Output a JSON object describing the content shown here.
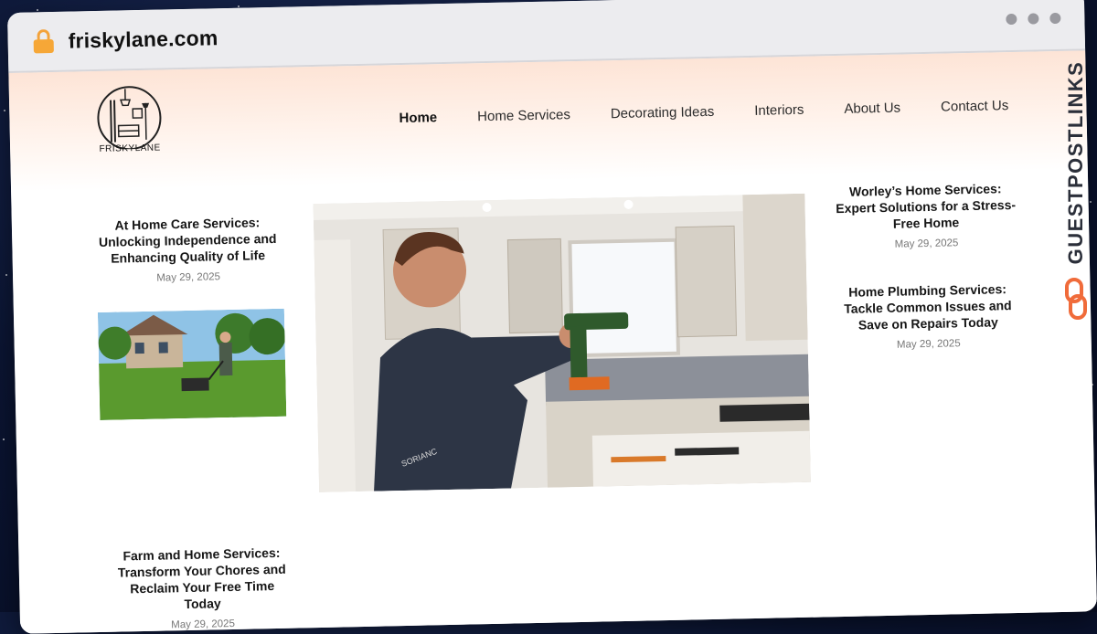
{
  "browser": {
    "url": "friskylane.com"
  },
  "site": {
    "logo_text": "FRISKYLANE",
    "nav": [
      "Home",
      "Home Services",
      "Decorating Ideas",
      "Interiors",
      "About Us",
      "Contact Us"
    ],
    "active_nav": "Home"
  },
  "articles": {
    "left_top": {
      "title": "At Home Care Services: Unlocking Independence and Enhancing Quality of Life",
      "date": "May 29, 2025"
    },
    "left_bottom": {
      "title": "Farm and Home Services: Transform Your Chores and Reclaim Your Free Time Today",
      "date": "May 29, 2025"
    },
    "right_top": {
      "title": "Worley’s Home Services: Expert Solutions for a Stress-Free Home",
      "date": "May 29, 2025"
    },
    "right_bottom": {
      "title": "Home Plumbing Services: Tackle Common Issues and Save on Repairs Today",
      "date": "May 29, 2025"
    }
  },
  "hero": {
    "shirt_text": "SORIANC"
  },
  "watermark": {
    "text": "GUESTPOSTLINKS",
    "icon": "chain-link-icon"
  },
  "colors": {
    "accent": "#f06b3a",
    "nav_text": "#2c2c2c",
    "date_text": "#777777"
  }
}
